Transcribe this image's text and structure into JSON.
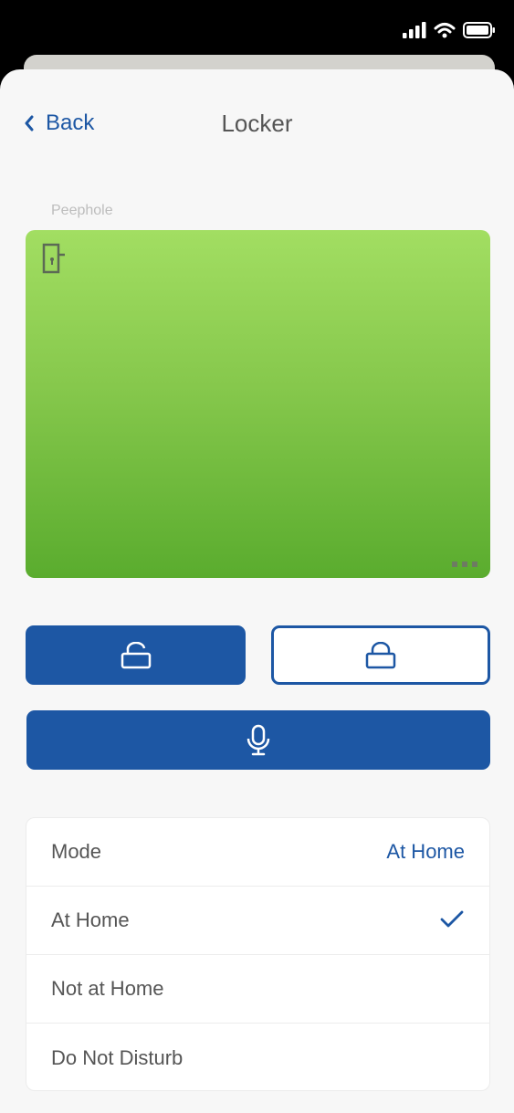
{
  "status": {
    "signal_icon": "cellular-signal-icon",
    "wifi_icon": "wifi-icon",
    "battery_icon": "battery-icon"
  },
  "nav": {
    "back_label": "Back",
    "title": "Locker",
    "back_icon": "chevron-left-icon"
  },
  "peephole": {
    "label": "Peephole",
    "door_icon": "door-icon",
    "more_icon": "more-dots-icon"
  },
  "actions": {
    "unlock_icon": "unlock-icon",
    "lock_icon": "lock-icon",
    "mic_icon": "microphone-icon"
  },
  "mode": {
    "header_label": "Mode",
    "current_value": "At Home",
    "options": [
      {
        "label": "At Home",
        "selected": true
      },
      {
        "label": "Not at Home",
        "selected": false
      },
      {
        "label": "Do Not Disturb",
        "selected": false
      }
    ]
  },
  "colors": {
    "accent": "#1d57a4",
    "sheet_bg": "#f7f7f7",
    "peephole_top": "#a2de62",
    "peephole_bottom": "#5aac2e"
  }
}
